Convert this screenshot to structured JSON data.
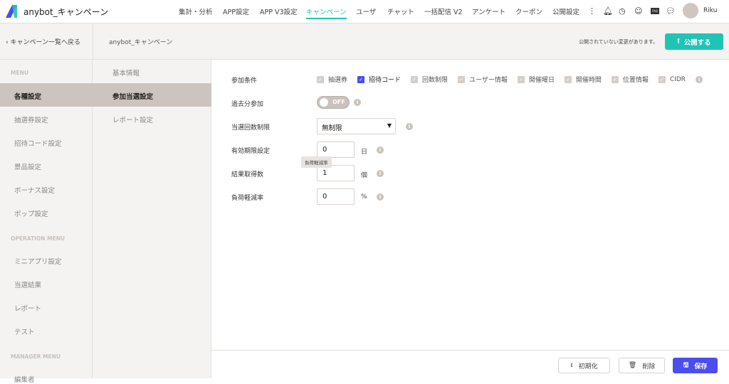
{
  "app": {
    "title": "anybot_キャンペーン",
    "user": "Riku"
  },
  "nav": [
    "集計・分析",
    "APP設定",
    "APP V3設定",
    "キャンペーン",
    "ユーザ",
    "チャット",
    "一括配信 V2",
    "アンケート",
    "クーポン",
    "公開設定"
  ],
  "header_icons": [
    "more-vertical-icon",
    "bell-icon",
    "clock-icon",
    "support-icon",
    "faq-icon",
    "chat-icon"
  ],
  "faq_label": "FAQ",
  "subheader": {
    "back": "‹ キャンペーン一覧へ戻る",
    "campaign": "anybot_キャンペーン",
    "unpublished": "公開されていない変更があります。",
    "publish": "公開する"
  },
  "sidebar": {
    "menu": "MENU",
    "items": [
      "各種設定",
      "抽選券設定",
      "招待コード設定",
      "景品設定",
      "ボーナス設定",
      "ポップ設定"
    ],
    "operation": "OPERATION MENU",
    "op_items": [
      "ミニアプリ設定",
      "当選結果",
      "レポート",
      "テスト"
    ],
    "manager": "MANAGER MENU",
    "mgr_items": [
      "編集者"
    ]
  },
  "subnav": [
    "基本情報",
    "参加当選設定",
    "レポート設定"
  ],
  "form": {
    "conditions_label": "参加条件",
    "conditions": [
      {
        "label": "抽選券",
        "checked": false
      },
      {
        "label": "招待コード",
        "checked": true
      },
      {
        "label": "回数制限",
        "checked": false
      },
      {
        "label": "ユーザー情報",
        "checked": false
      },
      {
        "label": "開催曜日",
        "checked": false
      },
      {
        "label": "開催時間",
        "checked": false
      },
      {
        "label": "位置情報",
        "checked": false
      },
      {
        "label": "CIDR",
        "checked": false
      }
    ],
    "past_label": "過去分参加",
    "past_value": "OFF",
    "limit_label": "当選回数制限",
    "limit_value": "無制限",
    "expiry_label": "有効期限設定",
    "expiry_value": "0",
    "expiry_unit": "日",
    "results_label": "結果取得数",
    "results_value": "1",
    "results_unit": "個",
    "load_label": "負荷軽減率",
    "load_value": "0",
    "load_unit": "%",
    "tooltip": "負荷軽減率"
  },
  "footer": {
    "reset": "初期化",
    "delete": "削除",
    "save": "保存"
  },
  "colors": {
    "accent": "#1ec4b4",
    "primary": "#4a4df0",
    "selected": "#cbc4bf"
  }
}
